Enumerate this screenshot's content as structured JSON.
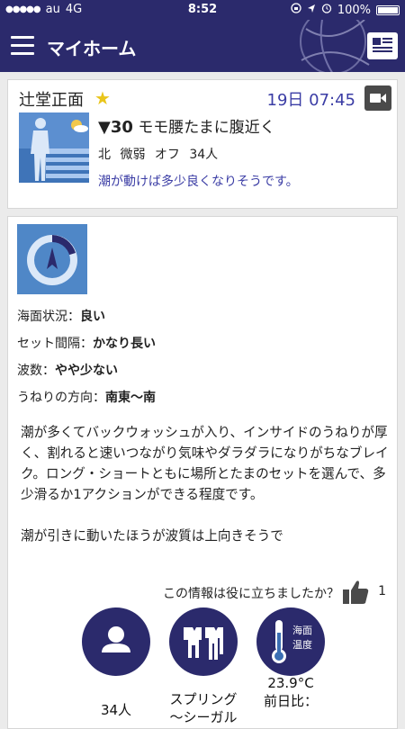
{
  "status_bar": {
    "carrier": "au",
    "network": "4G",
    "time": "8:52",
    "battery": "100%",
    "battery_level": 1.0
  },
  "header": {
    "title": "マイホーム"
  },
  "spot_card": {
    "spot_name": "辻堂正面",
    "date_time": "19日 07:45",
    "score": "▼30",
    "headline": "モモ腰たまに腹近く",
    "wind_direction": "北",
    "wind_strength": "微弱",
    "wind_type": "オフ",
    "people": "34人",
    "note": "潮が動けば多少良くなりそうです。"
  },
  "detail": {
    "rows": [
      {
        "label": "海面状況：",
        "value": "良い"
      },
      {
        "label": "セット間隔：",
        "value": "かなり長い"
      },
      {
        "label": "波数：",
        "value": "やや少ない"
      },
      {
        "label": "うねりの方向：",
        "value": "南東〜南"
      }
    ],
    "description": "潮が多くてバックウォッシュが入り、インサイドのうねりが厚く、割れると速いつながり気味やダラダラになりがちなブレイク。ロング・ショートともに場所とたまのセットを選んで、多少滑るか1アクションができる程度です。",
    "description2": "潮が引きに動いたほうが波質は上向きそうで",
    "helpful_question": "この情報は役に立ちましたか？",
    "like_count": "1",
    "sea_temp_label": "海面温度",
    "stats": {
      "people": "34人",
      "suit_line1": "スプリング",
      "suit_line2": "〜シーガル",
      "temp_line1": "23.9°C",
      "temp_line2": "前日比："
    }
  },
  "colors": {
    "navy": "#2b2a6c",
    "accent_blue": "#3b3da5",
    "star": "#e9c51a"
  }
}
